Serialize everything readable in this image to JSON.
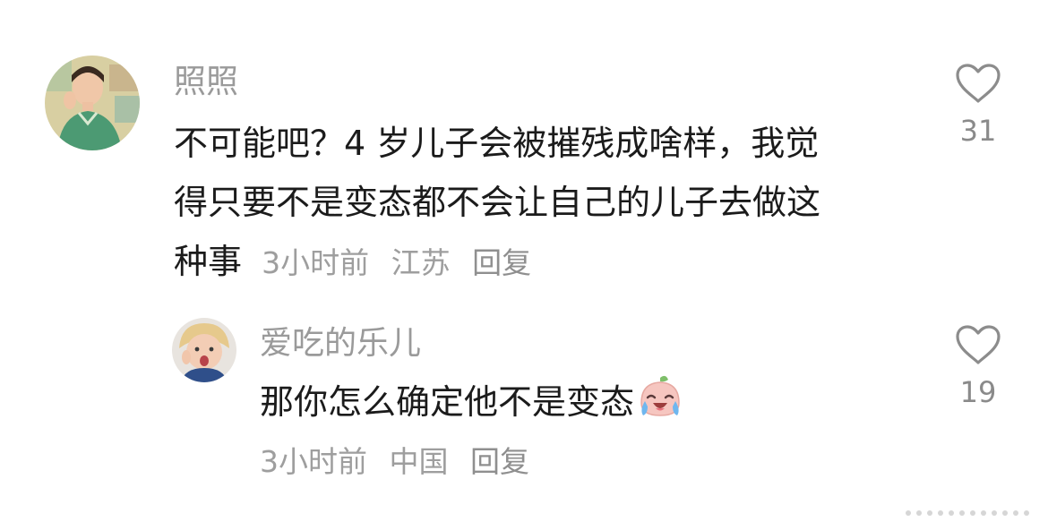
{
  "comments": [
    {
      "username": "照照",
      "text_lines": [
        "不可能吧？4 岁儿子会被摧残成啥样，我觉",
        "得只要不是变态都不会让自己的儿子去做这",
        "种事"
      ],
      "time": "3小时前",
      "location": "江苏",
      "reply_label": "回复",
      "likes": "31",
      "avatar_icon": "woman-portrait-avatar"
    },
    {
      "username": "爱吃的乐儿",
      "text": "那你怎么确定他不是变态",
      "emoji_icon": "laugh-cry-peach-emoji",
      "time": "3小时前",
      "location": "中国",
      "reply_label": "回复",
      "likes": "19",
      "avatar_icon": "child-portrait-avatar"
    }
  ],
  "colors": {
    "username": "#9a9a9a",
    "text": "#1b1b1b",
    "meta": "#9e9e9e",
    "heart_outline": "#8c8c8c"
  }
}
